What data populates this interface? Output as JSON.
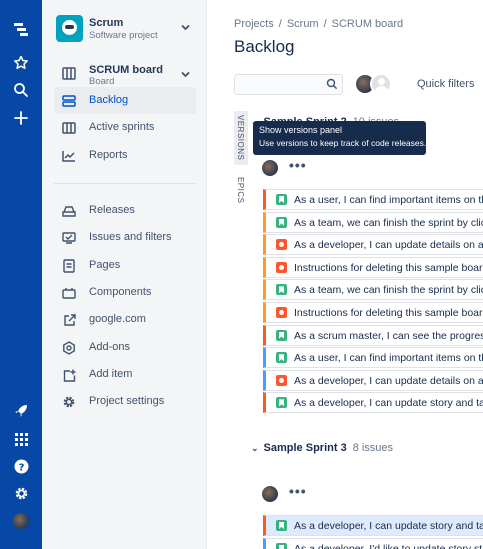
{
  "global_nav": {
    "icons": [
      "jira-logo-icon",
      "star-icon",
      "search-icon",
      "create-plus-icon",
      "rocket-icon",
      "app-switcher-icon",
      "help-icon",
      "settings-icon",
      "profile-avatar"
    ]
  },
  "project": {
    "name": "Scrum",
    "type": "Software project"
  },
  "board": {
    "name": "SCRUM board",
    "type": "Board"
  },
  "sidebar": {
    "items": [
      {
        "label": "Backlog",
        "icon": "backlog-icon",
        "active": true
      },
      {
        "label": "Active sprints",
        "icon": "active-sprints-icon"
      },
      {
        "label": "Reports",
        "icon": "reports-icon"
      },
      {
        "label": "Releases",
        "icon": "releases-icon"
      },
      {
        "label": "Issues and filters",
        "icon": "issues-filters-icon"
      },
      {
        "label": "Pages",
        "icon": "pages-icon"
      },
      {
        "label": "Components",
        "icon": "components-icon"
      },
      {
        "label": "google.com",
        "icon": "external-link-icon"
      },
      {
        "label": "Add-ons",
        "icon": "add-ons-icon"
      },
      {
        "label": "Add item",
        "icon": "add-item-icon"
      },
      {
        "label": "Project settings",
        "icon": "gear-icon"
      }
    ]
  },
  "breadcrumbs": [
    "Projects",
    "Scrum",
    "SCRUM board"
  ],
  "page_title": "Backlog",
  "search": {
    "placeholder": ""
  },
  "quick_filters_label": "Quick filters",
  "side_tabs": {
    "versions": "VERSIONS",
    "epics": "EPICS"
  },
  "tooltip": {
    "title": "Show versions panel",
    "body": "Use versions to keep track of code releases."
  },
  "sprint1": {
    "name": "Sample Sprint 2",
    "count": "10 issues",
    "issues": [
      {
        "type": "story",
        "summary": "As a user, I can find important items on the",
        "color": "#ff5630"
      },
      {
        "type": "story",
        "summary": "As a team, we can finish the sprint by clicki",
        "color": "#ff991f"
      },
      {
        "type": "bug",
        "summary": "As a developer, I can update details on an i",
        "color": "#ff991f"
      },
      {
        "type": "bug",
        "summary": "Instructions for deleting this sample board",
        "color": "#ff991f"
      },
      {
        "type": "story",
        "summary": "As a team, we can finish the sprint by clicki",
        "color": "#ff991f"
      },
      {
        "type": "bug",
        "summary": "Instructions for deleting this sample board",
        "color": "#ff991f"
      },
      {
        "type": "story",
        "summary": "As a scrum master, I can see the progress c",
        "color": "#ff5630"
      },
      {
        "type": "story",
        "summary": "As a user, I can find important items on the",
        "color": "#4c9aff"
      },
      {
        "type": "bug",
        "summary": "As a developer, I can update details on an i",
        "color": "#4c9aff"
      },
      {
        "type": "story",
        "summary": "As a developer, I can update story and task",
        "color": "#ff5630"
      }
    ]
  },
  "sprint2": {
    "name": "Sample Sprint 3",
    "count": "8 issues",
    "issues": [
      {
        "type": "story",
        "summary": "As a developer, I can update story and task",
        "color": "#ff5630"
      },
      {
        "type": "story",
        "summary": "As a developer, I'd like to update story stat",
        "color": "#4c9aff"
      }
    ]
  },
  "colors": {
    "nav": "#0747a6",
    "accent": "#0052cc"
  }
}
